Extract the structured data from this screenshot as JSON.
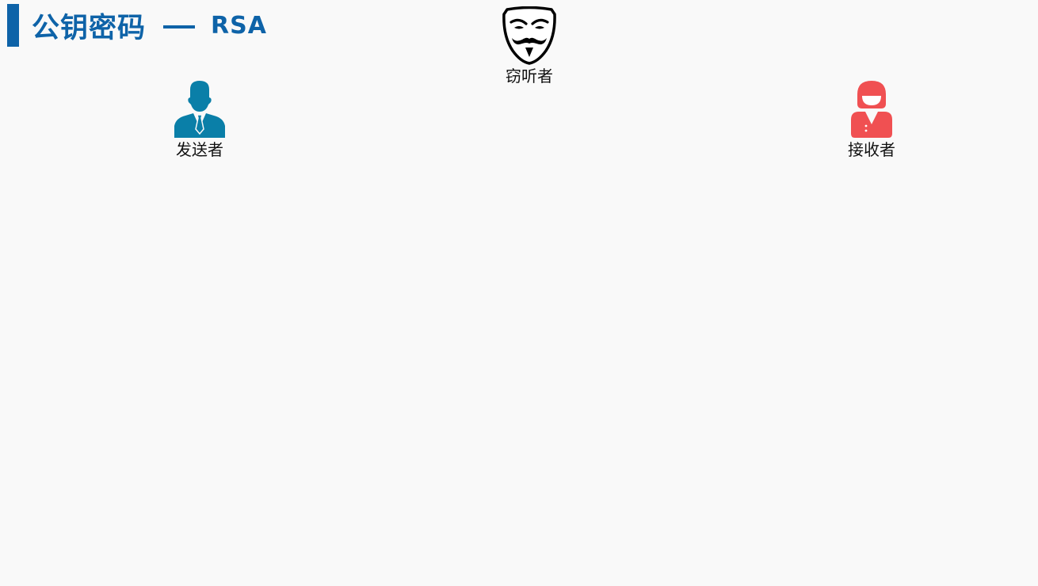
{
  "header": {
    "title_main": "公钥密码",
    "title_sub": "RSA"
  },
  "actors": {
    "eavesdropper": {
      "label": "窃听者",
      "icon": "mask-icon"
    },
    "sender": {
      "label": "发送者",
      "icon": "businessman-icon"
    },
    "receiver": {
      "label": "接收者",
      "icon": "woman-icon"
    }
  },
  "colors": {
    "accent": "#0e63a8",
    "sender": "#0a7fa8",
    "receiver": "#f05052",
    "eavesdropper": "#000000",
    "background": "#f9f9f9"
  }
}
